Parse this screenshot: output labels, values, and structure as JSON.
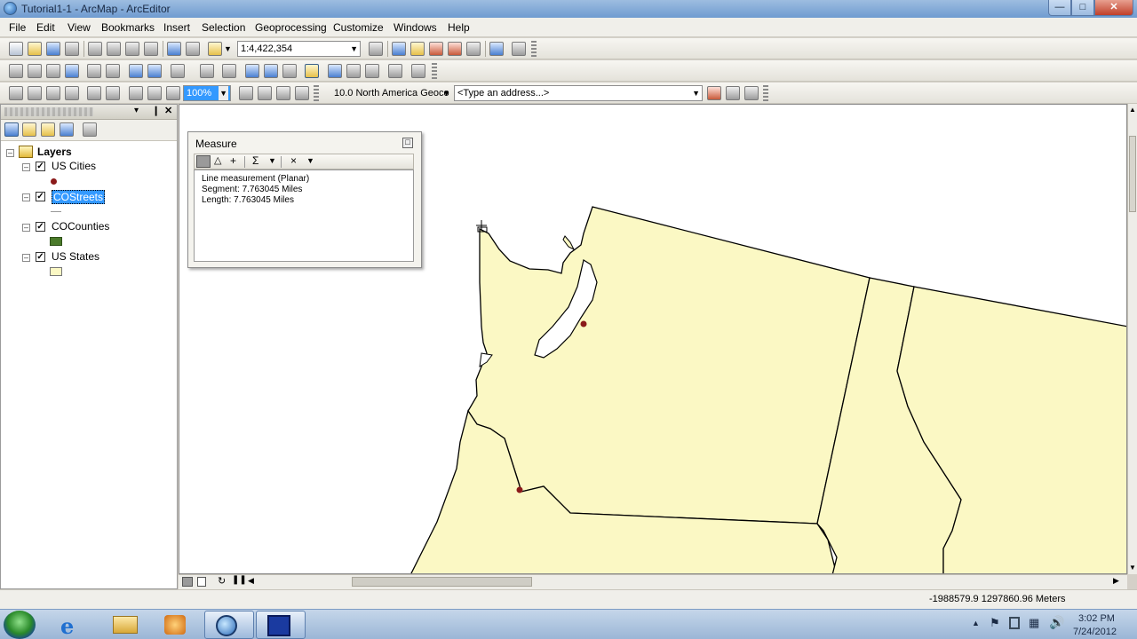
{
  "window": {
    "title": "Tutorial1-1 - ArcMap - ArcEditor"
  },
  "menu": [
    "File",
    "Edit",
    "View",
    "Bookmarks",
    "Insert",
    "Selection",
    "Geoprocessing",
    "Customize",
    "Windows",
    "Help"
  ],
  "toolbar": {
    "scale": "1:4,422,354",
    "zoom_percent": "100%",
    "geocoder": "10.0 North America Geoco",
    "address_placeholder": "<Type an address...>"
  },
  "toc": {
    "root_label": "Layers",
    "layers": [
      {
        "name": "US Cities",
        "checked": true,
        "symbol": "point-dark-red",
        "selected": false
      },
      {
        "name": "COStreets",
        "checked": true,
        "symbol": "line-gray",
        "selected": true
      },
      {
        "name": "COCounties",
        "checked": true,
        "symbol": "fill-green",
        "selected": false
      },
      {
        "name": "US States",
        "checked": true,
        "symbol": "fill-pale-yellow",
        "selected": false
      }
    ]
  },
  "measure": {
    "title": "Measure",
    "line1": "Line measurement (Planar)",
    "line2": "Segment: 7.763045 Miles",
    "line3": "Length: 7.763045 Miles"
  },
  "status": {
    "coordinates": "-1988579.9  1297860.96 Meters"
  },
  "clock": {
    "time": "3:02 PM",
    "date": "7/24/2012"
  },
  "colors": {
    "state_fill": "#fbf8c4",
    "city_point": "#8b1a1a",
    "counties_fill": "#4a7a2a",
    "selection": "#3399ff"
  }
}
